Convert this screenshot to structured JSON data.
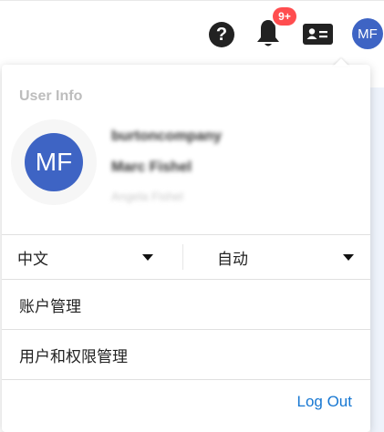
{
  "topbar": {
    "help_glyph": "?",
    "notification_badge": "9+",
    "avatar_initials": "MF",
    "icons": [
      "help-icon",
      "bell-icon",
      "contact-card-icon"
    ]
  },
  "colors": {
    "avatar_bg": "#3e64c4",
    "badge_bg": "#ff4d4f",
    "link": "#1677d2"
  },
  "user_panel": {
    "title": "User Info",
    "avatar_initials": "MF",
    "company": "burtoncompany",
    "name": "Marc Fishel",
    "subname": "Angela Fishel",
    "language_select": {
      "value": "中文"
    },
    "theme_select": {
      "value": "自动"
    },
    "menu": [
      {
        "label": "账户管理"
      },
      {
        "label": "用户和权限管理"
      }
    ],
    "logout_label": "Log Out"
  }
}
